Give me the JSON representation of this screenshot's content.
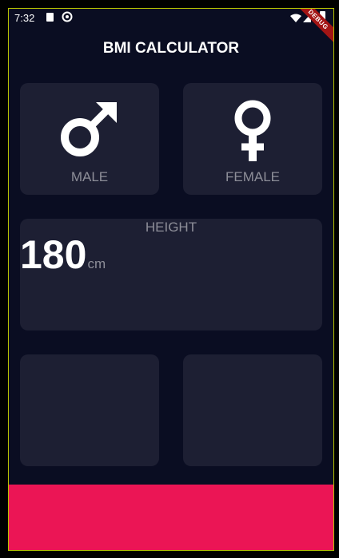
{
  "status_bar": {
    "time": "7:32",
    "debug_label": "DEBUG"
  },
  "app_bar": {
    "title": "BMI CALCULATOR"
  },
  "gender": {
    "male": {
      "label": "MALE",
      "icon": "male-symbol-icon"
    },
    "female": {
      "label": "FEMALE",
      "icon": "female-symbol-icon"
    }
  },
  "height": {
    "label": "HEIGHT",
    "value": "180",
    "unit": "cm"
  },
  "colors": {
    "background": "#0a0d22",
    "card": "#1d1f33",
    "label": "#8d8e98",
    "bottom_button": "#eb1555"
  }
}
